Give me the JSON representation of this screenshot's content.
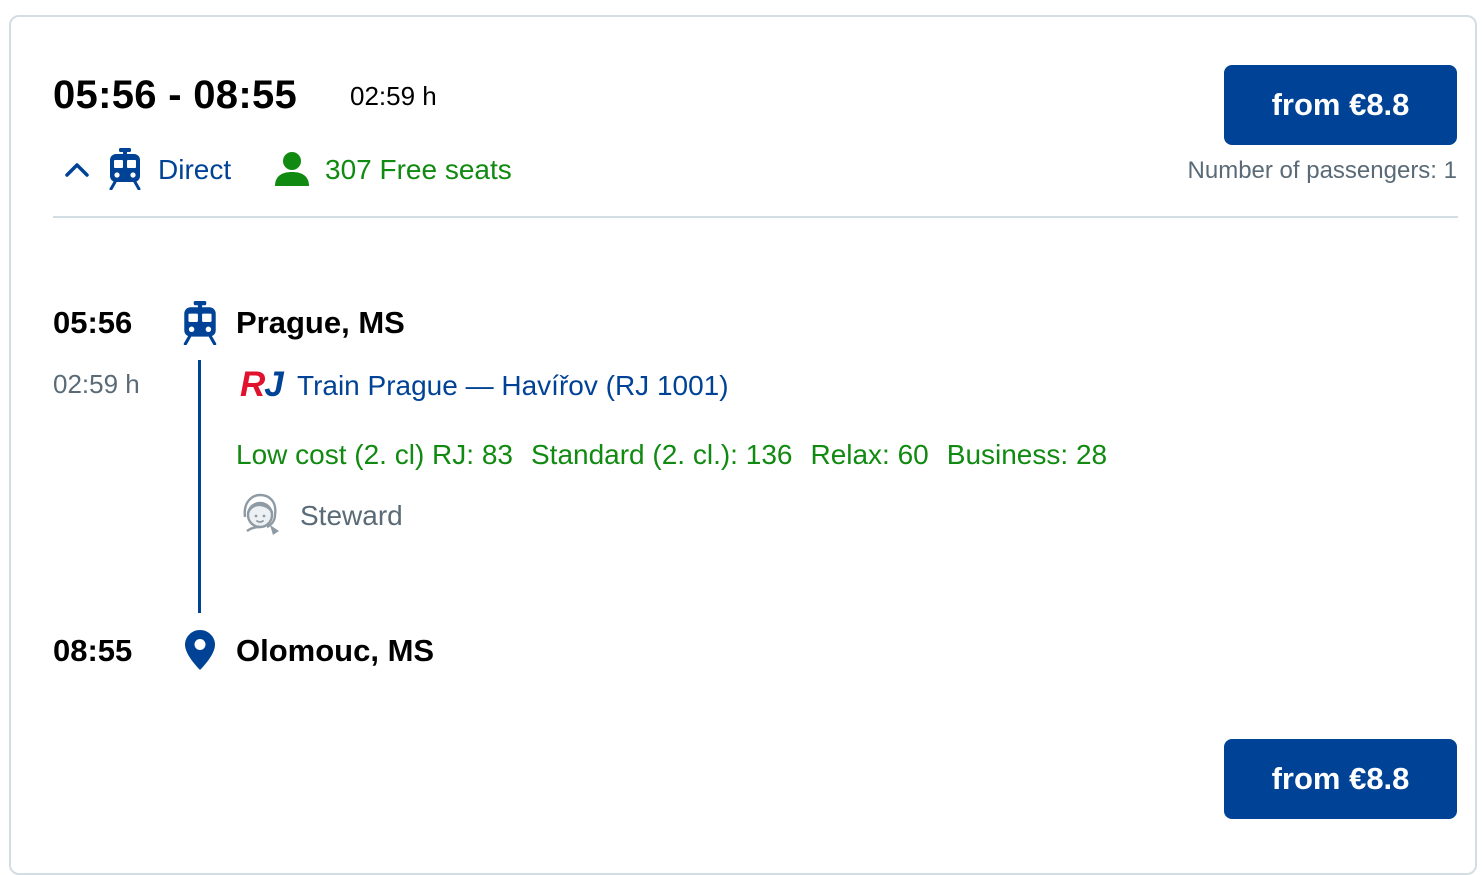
{
  "summary": {
    "times_range": "05:56 - 08:55",
    "duration": "02:59 h",
    "price_label": "from €8.8",
    "connection_type": "Direct",
    "free_seats": "307 Free seats",
    "passengers": "Number of passengers: 1"
  },
  "itinerary": {
    "departure_time": "05:56",
    "departure_station": "Prague, MS",
    "segment_duration": "02:59 h",
    "carrier_logo": {
      "r": "R",
      "j": "J"
    },
    "train_name": "Train Prague — Havířov (RJ 1001)",
    "classes": [
      "Low cost (2. cl) RJ: 83",
      "Standard (2. cl.): 136",
      "Relax: 60",
      "Business: 28"
    ],
    "amenity": "Steward",
    "arrival_time": "08:55",
    "arrival_station": "Olomouc, MS"
  },
  "footer": {
    "price_label": "from €8.8"
  },
  "icons": {
    "collapse": "chevron-up-icon",
    "train": "train-icon",
    "person": "person-icon",
    "steward": "steward-icon",
    "destination": "map-pin-icon"
  },
  "colors": {
    "brand_blue": "#004396",
    "green": "#118a11",
    "muted": "#5a6b77",
    "rj_red": "#e0122e",
    "border": "#d3dde4"
  }
}
